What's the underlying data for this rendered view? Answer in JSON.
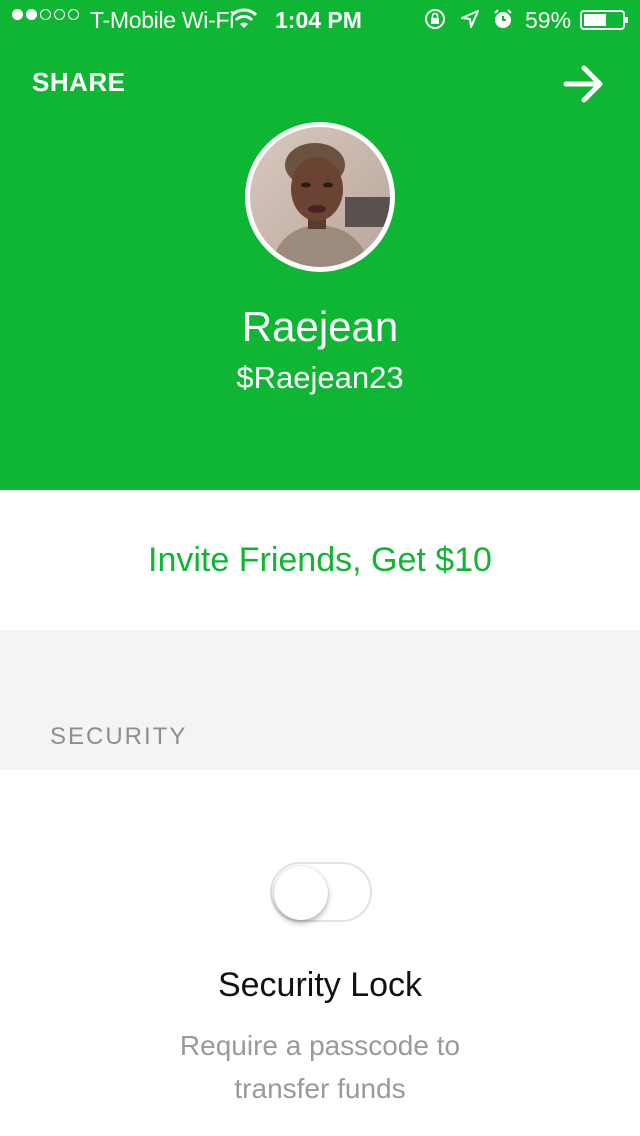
{
  "status_bar": {
    "signal_bars_filled": 2,
    "signal_bars_total": 5,
    "carrier": "T-Mobile Wi-Fi",
    "time": "1:04 PM",
    "battery_percent": "59%",
    "battery_level": 0.59,
    "icons": [
      "wifi-icon",
      "rotation-lock-icon",
      "location-icon",
      "alarm-icon",
      "battery-icon"
    ]
  },
  "header": {
    "share_label": "SHARE",
    "forward_icon": "arrow-right-icon",
    "background_color": "#0fb634"
  },
  "profile": {
    "name": "Raejean",
    "handle": "$Raejean23"
  },
  "invite": {
    "label": "Invite Friends, Get $10",
    "color": "#10b532"
  },
  "security": {
    "section_title": "SECURITY",
    "toggle_on": false,
    "lock_title": "Security Lock",
    "lock_description": "Require a passcode to transfer funds"
  }
}
